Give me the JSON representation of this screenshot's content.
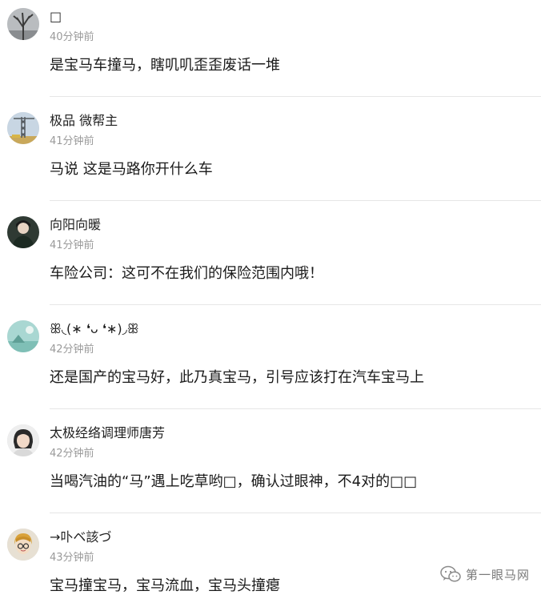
{
  "comments": [
    {
      "username": "□",
      "time": "40分钟前",
      "text": "是宝马车撞马，瞎叽叽歪歪废话一堆",
      "avatar": "bare-tree-avatar"
    },
    {
      "username": "极品 微帮主",
      "time": "41分钟前",
      "text": "马说 这是马路你开什么车",
      "avatar": "crane-tower-avatar"
    },
    {
      "username": "向阳向暖",
      "time": "41分钟前",
      "text": "车险公司：这可不在我们的保险范围内哦！",
      "avatar": "dark-portrait-avatar"
    },
    {
      "username": "ꕥ◟(∗ ❛ᴗ ❛∗)◞ꕥ",
      "time": "42分钟前",
      "text": "还是国产的宝马好，此乃真宝马，引号应该打在汽车宝马上",
      "avatar": "teal-landscape-avatar"
    },
    {
      "username": "太极经络调理师唐芳",
      "time": "42分钟前",
      "text": "当喝汽油的“马”遇上吃草哟□，确认过眼神，不4对的□□",
      "avatar": "woman-portrait-avatar"
    },
    {
      "username": "→卟ベ該づ",
      "time": "43分钟前",
      "text": "宝马撞宝马，宝马流血，宝马头撞瘪",
      "avatar": "cartoon-boy-avatar"
    }
  ],
  "watermark": {
    "text": "第一眼马网",
    "icon": "wechat-icon"
  }
}
